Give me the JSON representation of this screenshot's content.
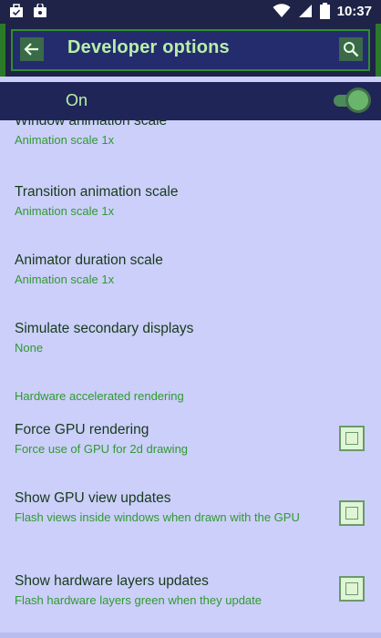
{
  "status_bar": {
    "time": "10:37",
    "left_icons": [
      "briefcase-check-icon",
      "shopping-bag-icon"
    ],
    "right_icons": [
      "wifi-icon",
      "signal-icon",
      "battery-icon"
    ]
  },
  "app_bar": {
    "title": "Developer options",
    "back_icon": "arrow-left-icon",
    "search_icon": "search-icon"
  },
  "master_switch": {
    "label": "On",
    "state": "on"
  },
  "list": {
    "items": [
      {
        "title": "Window animation scale",
        "subtitle": "Animation scale 1x"
      },
      {
        "title": "Transition animation scale",
        "subtitle": "Animation scale 1x"
      },
      {
        "title": "Animator duration scale",
        "subtitle": "Animation scale 1x"
      },
      {
        "title": "Simulate secondary displays",
        "subtitle": "None"
      }
    ],
    "section_header": "Hardware accelerated rendering",
    "check_items": [
      {
        "title": "Force GPU rendering",
        "subtitle": "Force use of GPU for 2d drawing",
        "checked": false
      },
      {
        "title": "Show GPU view updates",
        "subtitle": "Flash views inside windows when drawn with the GPU",
        "checked": false
      },
      {
        "title": "Show hardware layers updates",
        "subtitle": "Flash hardware layers green when they update",
        "checked": false
      }
    ]
  },
  "colors": {
    "background": "#cccffa",
    "app_bar": "#252c6e",
    "accent_green": "#2f9a2f",
    "title_text": "#b7f0a8"
  }
}
